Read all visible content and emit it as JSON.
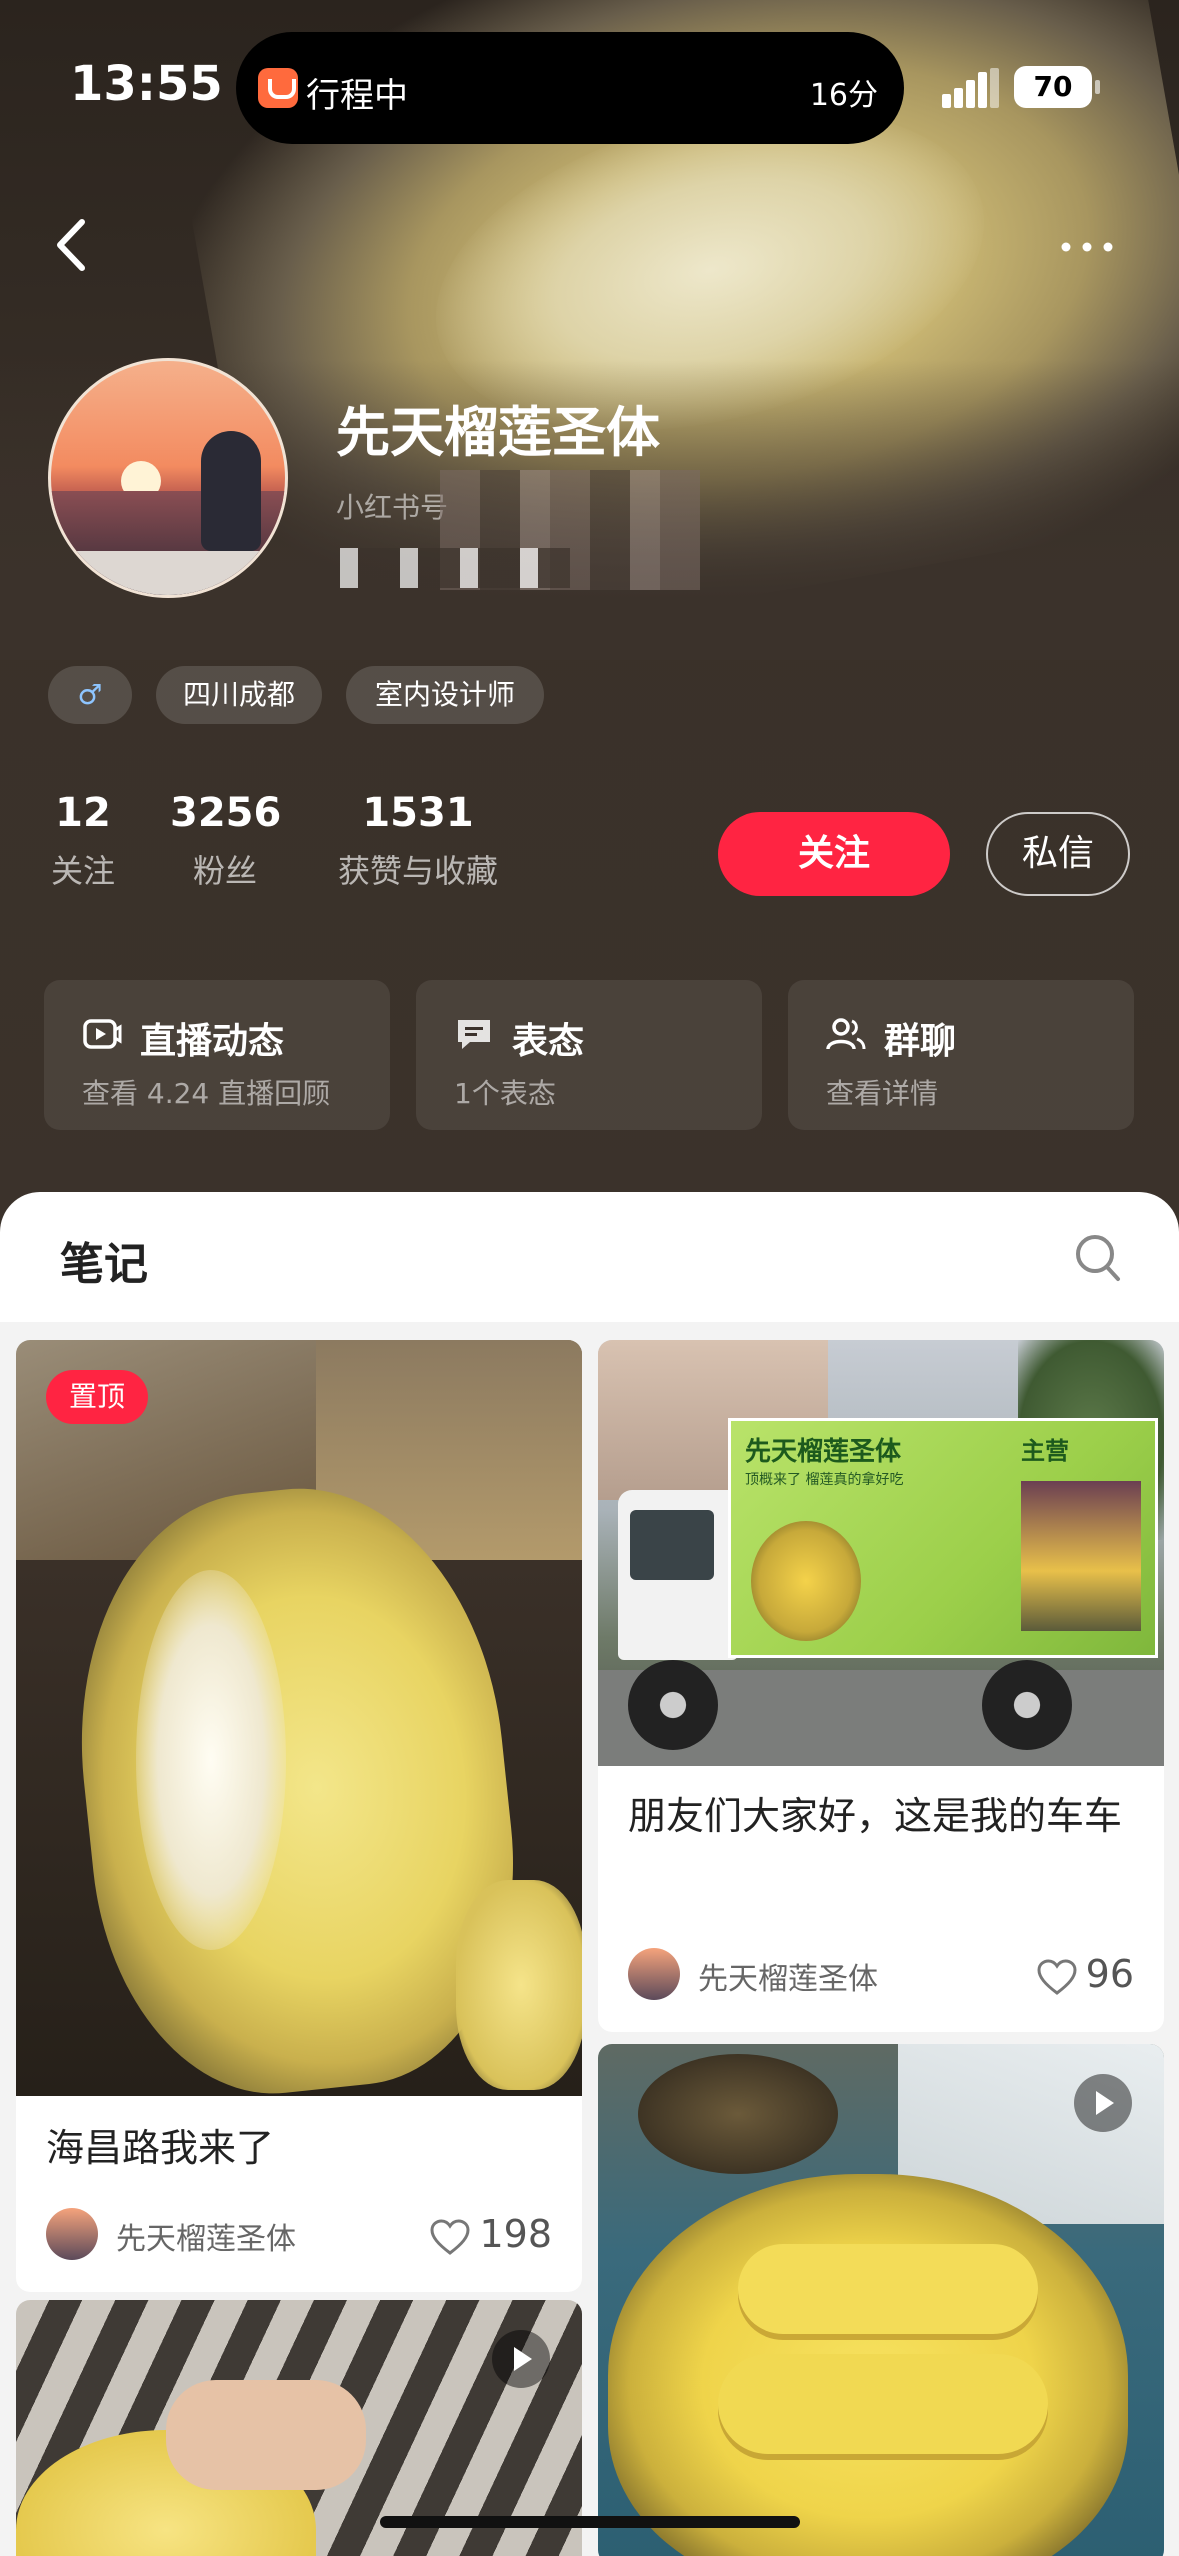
{
  "status_bar": {
    "time": "13:55",
    "island_text": "行程中",
    "island_eta": "16分",
    "battery": "70"
  },
  "profile": {
    "name": "先天榴莲圣体",
    "red_id_prefix": "小红书号",
    "tags": [
      "♂",
      "四川成都",
      "室内设计师"
    ],
    "stats": [
      {
        "num": "12",
        "label": "关注"
      },
      {
        "num": "3256",
        "label": "粉丝"
      },
      {
        "num": "1531",
        "label": "获赞与收藏"
      }
    ],
    "follow_label": "关注",
    "message_label": "私信"
  },
  "cards": [
    {
      "title": "直播动态",
      "subtitle": "查看 4.24 直播回顾",
      "icon": "live-icon"
    },
    {
      "title": "表态",
      "subtitle": "1个表态",
      "icon": "chat-icon"
    },
    {
      "title": "群聊",
      "subtitle": "查看详情",
      "icon": "group-icon"
    }
  ],
  "notes": {
    "title": "笔记",
    "posts": [
      {
        "title": "海昌路我来了",
        "author": "先天榴莲圣体",
        "likes": "198",
        "pinned_label": "置顶"
      },
      {
        "title": "朋友们大家好，这是我的车车",
        "author": "先天榴莲圣体",
        "likes": "96"
      }
    ],
    "truck_banner": "先天榴莲圣体",
    "truck_sub": "顶概来了 榴莲真的拿好吃",
    "truck_side": "主营"
  },
  "colors": {
    "accent": "#ff2442",
    "header_bg": "#3b322b"
  }
}
